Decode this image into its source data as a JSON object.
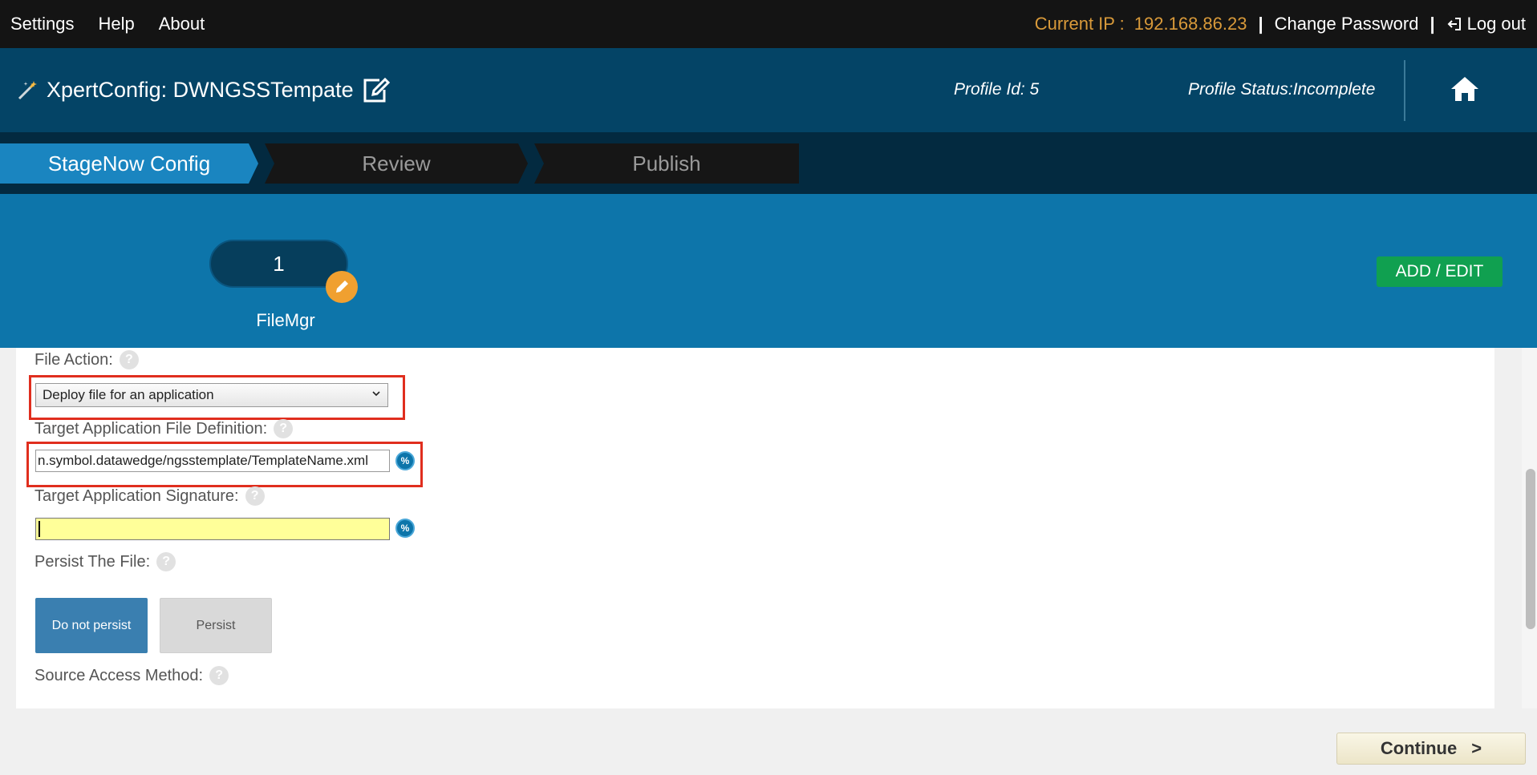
{
  "topbar": {
    "menu": [
      "Settings",
      "Help",
      "About"
    ],
    "ip_label": "Current IP :",
    "ip_value": "192.168.86.23",
    "separator": "|",
    "change_password": "Change Password",
    "logout": "Log out"
  },
  "header": {
    "title": "XpertConfig: DWNGSSTempate",
    "profile_id": "Profile Id: 5",
    "profile_status": "Profile Status:Incomplete"
  },
  "stages": [
    "StageNow Config",
    "Review",
    "Publish"
  ],
  "panel": {
    "step_number": "1",
    "step_label": "FileMgr",
    "add_edit": "ADD / EDIT"
  },
  "form": {
    "file_action_label": "File Action:",
    "file_action_value": "Deploy file for an application",
    "target_def_label": "Target Application File Definition:",
    "target_def_value": "n.symbol.datawedge/ngsstemplate/TemplateName.xml",
    "target_sig_label": "Target Application Signature:",
    "target_sig_value": "",
    "persist_label": "Persist The File:",
    "persist_options": [
      "Do not persist",
      "Persist"
    ],
    "source_access_label": "Source Access Method:",
    "help_glyph": "?",
    "pct_glyph": "%"
  },
  "continue_label": "Continue",
  "continue_arrow": ">",
  "colors": {
    "accent": "#1a85c0",
    "header": "#044466",
    "highlight": "#e02e1e",
    "ip": "#d99a3a"
  }
}
